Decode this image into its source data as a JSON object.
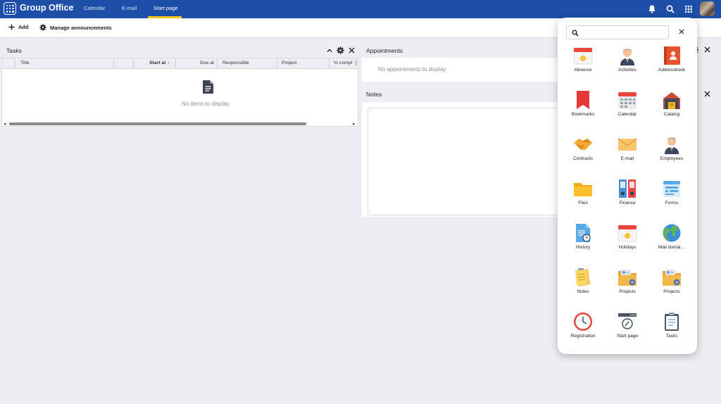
{
  "header": {
    "brand": "Group Office",
    "tabs": [
      {
        "label": "Calendar"
      },
      {
        "label": "E-mail"
      },
      {
        "label": "Start page"
      }
    ]
  },
  "toolbar": {
    "add_label": "Add",
    "announcements_label": "Manage announcements"
  },
  "tasks": {
    "title": "Tasks",
    "columns": [
      "Title",
      "Start at",
      "Due at",
      "Responsible",
      "Project",
      "% compl"
    ],
    "empty_text": "No items to display"
  },
  "appointments": {
    "title": "Appointments",
    "empty_text": "No appointments to display"
  },
  "notes": {
    "title": "Notes"
  },
  "launcher": {
    "search_value": "",
    "apps": [
      {
        "label": "Absence",
        "icon": "absence-icon"
      },
      {
        "label": "Activities",
        "icon": "activities-icon"
      },
      {
        "label": "Addressbook",
        "icon": "addressbook-icon"
      },
      {
        "label": "Bookmarks",
        "icon": "bookmarks-icon"
      },
      {
        "label": "Calendar",
        "icon": "calendar-icon"
      },
      {
        "label": "Catalog",
        "icon": "catalog-icon"
      },
      {
        "label": "Contracts",
        "icon": "contracts-icon"
      },
      {
        "label": "E-mail",
        "icon": "email-icon"
      },
      {
        "label": "Employees",
        "icon": "employees-icon"
      },
      {
        "label": "Files",
        "icon": "files-icon"
      },
      {
        "label": "Finance",
        "icon": "finance-icon"
      },
      {
        "label": "Forms",
        "icon": "forms-icon"
      },
      {
        "label": "History",
        "icon": "history-icon"
      },
      {
        "label": "Holidays",
        "icon": "holidays-icon"
      },
      {
        "label": "Mail domai…",
        "icon": "mail-domains-icon"
      },
      {
        "label": "Notes",
        "icon": "notes-icon"
      },
      {
        "label": "Projects",
        "icon": "projects-icon"
      },
      {
        "label": "Projects",
        "icon": "projects2-icon"
      },
      {
        "label": "Registration",
        "icon": "registration-icon"
      },
      {
        "label": "Start page",
        "icon": "start-page-icon"
      },
      {
        "label": "Tasks",
        "icon": "tasks-icon"
      }
    ]
  }
}
